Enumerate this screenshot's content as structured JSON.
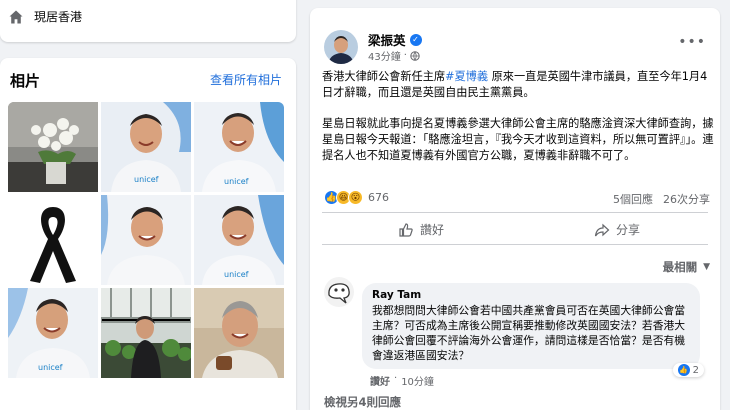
{
  "location": {
    "text": "現居香港",
    "icon": "home-icon"
  },
  "photos": {
    "title": "相片",
    "see_all": "查看所有相片",
    "items": [
      {
        "name": "photo-white-flowers",
        "desc": "flowers"
      },
      {
        "name": "photo-unicef-1",
        "shirt_text": "unicef"
      },
      {
        "name": "photo-unicef-2",
        "shirt_text": "unicef"
      },
      {
        "name": "photo-black-ribbon",
        "desc": "ribbon"
      },
      {
        "name": "photo-unicef-3",
        "shirt_text": ""
      },
      {
        "name": "photo-unicef-4",
        "shirt_text": "unicef"
      },
      {
        "name": "photo-unicef-5",
        "shirt_text": "unicef"
      },
      {
        "name": "photo-garden",
        "desc": "garden"
      },
      {
        "name": "photo-gray-hair",
        "desc": "portrait"
      }
    ]
  },
  "post": {
    "author": "梁振英",
    "time": "43分鐘",
    "paragraph1_pre": "香港大律師公會新任主席",
    "hashtag": "#夏博義",
    "paragraph1_post": " 原來一直是英國牛津市議員，直至今年1月4日才辭職，而且還是英國自由民主黨黨員。",
    "paragraph2": "星島日報就此事向提名夏博義參選大律師公會主席的駱應淦資深大律師查詢，據星島日報今天報道：「駱應淦坦言，『我今天才收到這資料，所以無可置評』」。連提名人也不知道夏博義有外國官方公職，夏博義非辭職不可了。",
    "reaction_count": "676",
    "comments_count": "5個回應",
    "shares_count": "26次分享",
    "like_label": "讚好",
    "share_label": "分享",
    "sort_label": "最相關"
  },
  "comment": {
    "author": "Ray Tam",
    "text": "我都想問問大律師公會若中國共產黨會員可否在英國大律師公會當主席？可否成為主席後公開宣稱要推動修改英國國安法？若香港大律師公會回覆不評論海外公會運作，請問這樣是否恰當？是否有機會違返港區國安法？",
    "like_count": "2",
    "like_action": "讚好",
    "time": "10分鐘"
  },
  "view_more": "檢視另4則回應",
  "colors": {
    "link": "#216fdb",
    "brand": "#1877f2",
    "muted": "#65676b",
    "bg": "#f0f2f5"
  }
}
